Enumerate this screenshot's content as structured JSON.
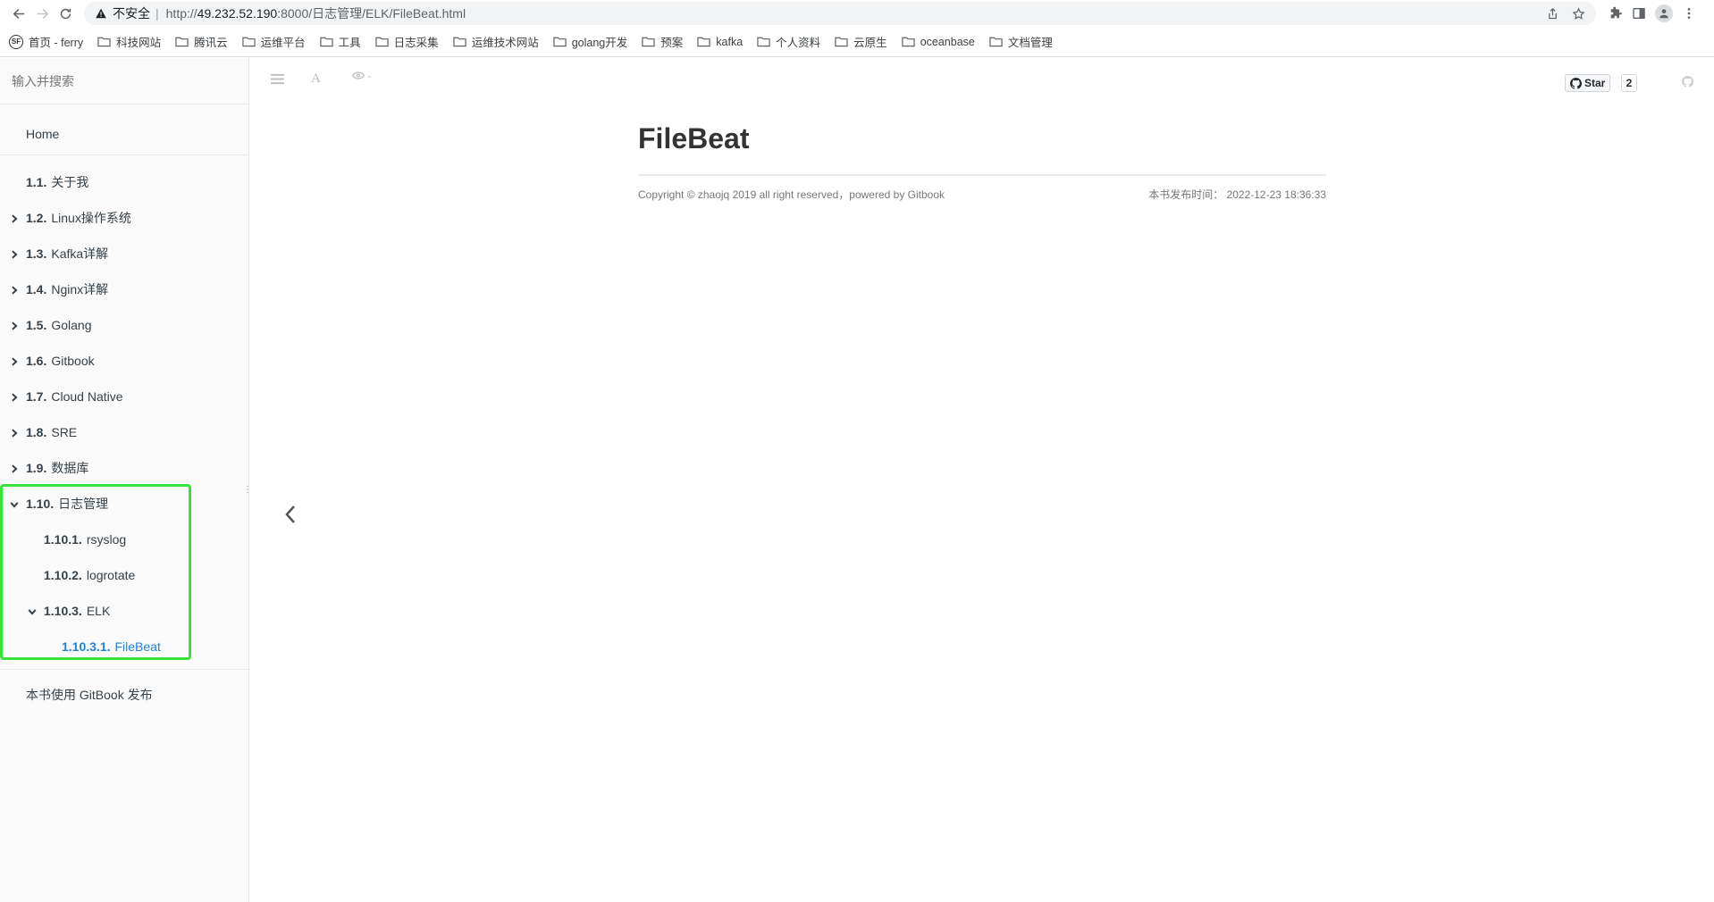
{
  "browser": {
    "insecure_label": "不安全",
    "url_prefix": "http://",
    "url_host": "49.232.52.190",
    "url_rest": ":8000/日志管理/ELK/FileBeat.html"
  },
  "bookmarks": [
    {
      "label": "首页 - ferry",
      "icon": "sf-icon"
    },
    {
      "label": "科技网站",
      "icon": "folder-icon"
    },
    {
      "label": "腾讯云",
      "icon": "folder-icon"
    },
    {
      "label": "运维平台",
      "icon": "folder-icon"
    },
    {
      "label": "工具",
      "icon": "folder-icon"
    },
    {
      "label": "日志采集",
      "icon": "folder-icon"
    },
    {
      "label": "运维技术网站",
      "icon": "folder-icon"
    },
    {
      "label": "golang开发",
      "icon": "folder-icon"
    },
    {
      "label": "预案",
      "icon": "folder-icon"
    },
    {
      "label": "kafka",
      "icon": "folder-icon"
    },
    {
      "label": "个人资料",
      "icon": "folder-icon"
    },
    {
      "label": "云原生",
      "icon": "folder-icon"
    },
    {
      "label": "oceanbase",
      "icon": "folder-icon"
    },
    {
      "label": "文档管理",
      "icon": "folder-icon"
    }
  ],
  "sidebar": {
    "search_placeholder": "输入并搜索",
    "home": "Home",
    "items": [
      {
        "num": "1.1.",
        "label": "关于我",
        "chevron": "none",
        "indent": 0
      },
      {
        "num": "1.2.",
        "label": "Linux操作系统",
        "chevron": "right",
        "indent": 0
      },
      {
        "num": "1.3.",
        "label": "Kafka详解",
        "chevron": "right",
        "indent": 0
      },
      {
        "num": "1.4.",
        "label": "Nginx详解",
        "chevron": "right",
        "indent": 0
      },
      {
        "num": "1.5.",
        "label": "Golang",
        "chevron": "right",
        "indent": 0
      },
      {
        "num": "1.6.",
        "label": "Gitbook",
        "chevron": "right",
        "indent": 0
      },
      {
        "num": "1.7.",
        "label": "Cloud Native",
        "chevron": "right",
        "indent": 0
      },
      {
        "num": "1.8.",
        "label": "SRE",
        "chevron": "right",
        "indent": 0
      },
      {
        "num": "1.9.",
        "label": "数据库",
        "chevron": "right",
        "indent": 0
      },
      {
        "num": "1.10.",
        "label": "日志管理",
        "chevron": "down",
        "indent": 0
      },
      {
        "num": "1.10.1.",
        "label": "rsyslog",
        "chevron": "none",
        "indent": 1
      },
      {
        "num": "1.10.2.",
        "label": "logrotate",
        "chevron": "none",
        "indent": 1
      },
      {
        "num": "1.10.3.",
        "label": "ELK",
        "chevron": "down",
        "indent": 1
      },
      {
        "num": "1.10.3.1.",
        "label": "FileBeat",
        "chevron": "none",
        "indent": 2,
        "active": true
      }
    ],
    "publish": "本书使用 GitBook 发布"
  },
  "header": {
    "star_label": "Star",
    "star_count": "2"
  },
  "article": {
    "title": "FileBeat",
    "copyright": "Copyright © zhaojq 2019 all right reserved，powered by Gitbook",
    "published": "本书发布时间： 2022-12-23 18:36:33"
  },
  "colors": {
    "active_link": "#2184d7",
    "highlight_box": "#3be23b"
  }
}
